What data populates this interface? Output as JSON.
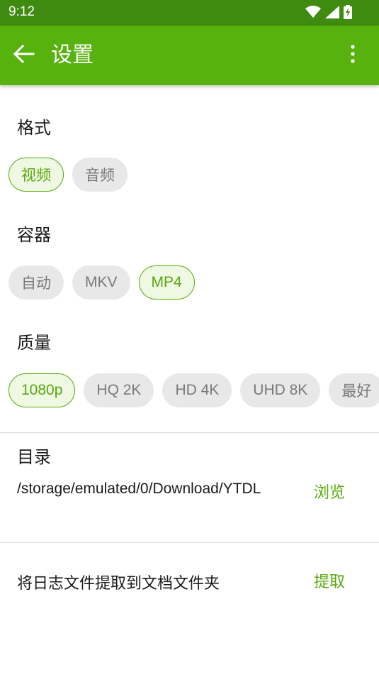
{
  "status_bar": {
    "time": "9:12",
    "icons": [
      "wifi-icon",
      "signal-icon",
      "battery-charging-icon"
    ]
  },
  "app_bar": {
    "title": "设置",
    "background": "#58b20e",
    "status_background": "#3f8a10"
  },
  "format": {
    "label": "格式",
    "chips": [
      {
        "label": "视频",
        "selected": true
      },
      {
        "label": "音频",
        "selected": false
      }
    ]
  },
  "container": {
    "label": "容器",
    "chips": [
      {
        "label": "自动",
        "selected": false
      },
      {
        "label": "MKV",
        "selected": false
      },
      {
        "label": "MP4",
        "selected": true
      }
    ]
  },
  "quality": {
    "label": "质量",
    "chips": [
      {
        "label": "1080p",
        "selected": true
      },
      {
        "label": "HQ 2K",
        "selected": false
      },
      {
        "label": "HD 4K",
        "selected": false
      },
      {
        "label": "UHD 8K",
        "selected": false
      },
      {
        "label": "最好",
        "selected": false
      }
    ]
  },
  "directory": {
    "label": "目录",
    "path": "/storage/emulated/0/Download/YTDL",
    "browse_label": "浏览"
  },
  "logs": {
    "text": "将日志文件提取到文档文件夹",
    "extract_label": "提取"
  },
  "colors": {
    "accent": "#5aa80d",
    "chip_bg": "#e8e8e8",
    "chip_selected_bg": "#eef8e2"
  }
}
